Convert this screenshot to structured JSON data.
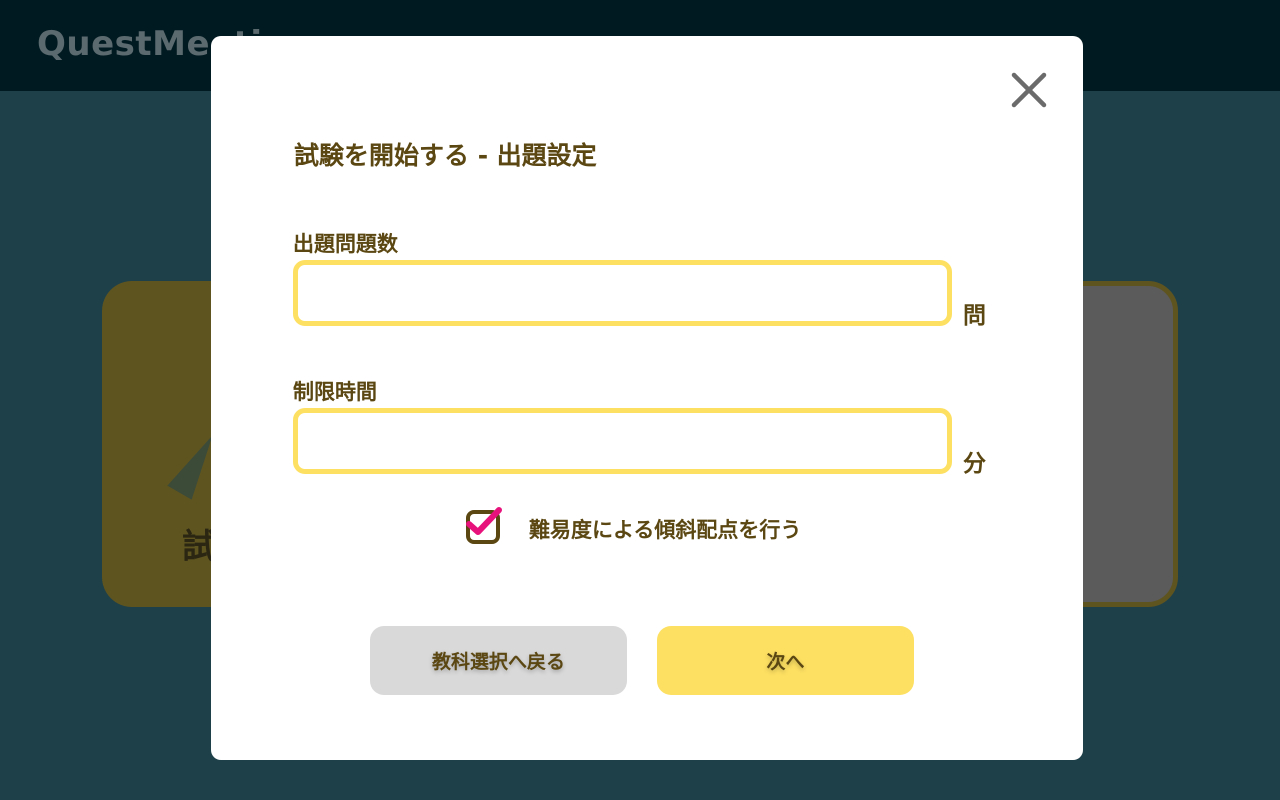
{
  "app": {
    "logo_text": "QuestMeeting"
  },
  "background": {
    "card_left_text": "試"
  },
  "modal": {
    "title": "試験を開始する - 出題設定",
    "question_count": {
      "label": "出題問題数",
      "value": "",
      "unit": "問"
    },
    "time_limit": {
      "label": "制限時間",
      "value": "",
      "unit": "分"
    },
    "weighted_scoring": {
      "label": "難易度による傾斜配点を行う",
      "checked": true
    },
    "back_button_label": "教科選択へ戻る",
    "next_button_label": "次へ"
  },
  "colors": {
    "accent_yellow": "#fde062",
    "text_brown": "#5b4712",
    "check_pink": "#e8127c",
    "header_dark": "#001a21",
    "background_teal": "#1e4049"
  },
  "icons": {
    "close": "close-icon",
    "check": "checkmark-icon"
  }
}
